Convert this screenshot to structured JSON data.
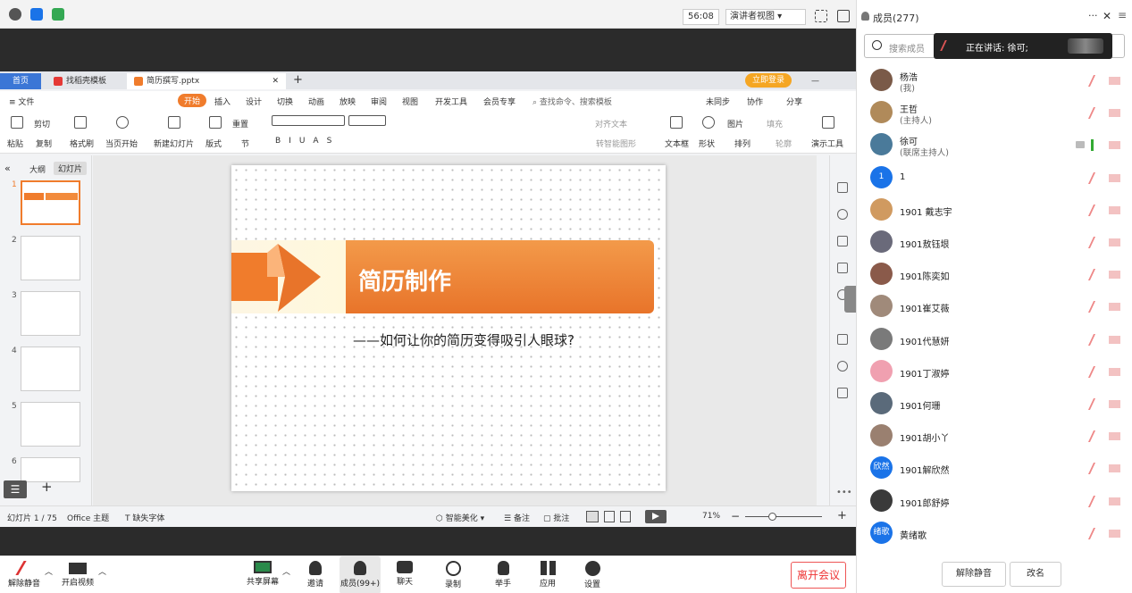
{
  "topbar": {
    "timer": "56:08",
    "view": "演讲者视图"
  },
  "wps": {
    "tabs": [
      {
        "label": "首页"
      },
      {
        "label": "找稻壳模板"
      },
      {
        "label": "简历撰写.pptx"
      }
    ],
    "login": "立即登录",
    "menu": [
      "≡ 文件",
      "开始",
      "插入",
      "设计",
      "切换",
      "动画",
      "放映",
      "审阅",
      "视图",
      "开发工具",
      "会员专享"
    ],
    "search": "查找命令、搜索模板",
    "right_menu": [
      "未同步",
      "协作",
      "分享"
    ],
    "ribbon": {
      "row1": [
        "剪切",
        "重置"
      ],
      "row2": [
        "粘贴",
        "复制",
        "格式刷",
        "当页开始",
        "新建幻灯片",
        "版式",
        "节",
        "文本框",
        "形状",
        "排列",
        "演示工具"
      ],
      "misc": [
        "对齐文本",
        "图片",
        "填充",
        "转智能图形",
        "轮廓"
      ]
    },
    "thumb_tabs": [
      "大纲",
      "幻灯片"
    ],
    "slide_numbers": [
      "1",
      "2",
      "3",
      "4",
      "5",
      "6"
    ],
    "slide": {
      "title": "简历制作",
      "subtitle": "——如何让你的简历变得吸引人眼球?"
    },
    "status": {
      "slide": "幻灯片 1 / 75",
      "theme": "Office 主题",
      "font": "缺失字体",
      "beautify": "智能美化",
      "notes": "备注",
      "comment": "批注",
      "zoom": "71%"
    }
  },
  "bottombar": {
    "items": [
      {
        "label": "解除静音"
      },
      {
        "label": "开启视频"
      },
      {
        "label": "共享屏幕"
      },
      {
        "label": "邀请"
      },
      {
        "label": "成员(99+)"
      },
      {
        "label": "聊天"
      },
      {
        "label": "录制"
      },
      {
        "label": "举手"
      },
      {
        "label": "应用"
      },
      {
        "label": "设置"
      }
    ],
    "leave": "离开会议"
  },
  "panel": {
    "title": "成员(277)",
    "search_placeholder": "搜索成员",
    "speaking": "正在讲话: 徐可;",
    "members": [
      {
        "name": "杨浩",
        "role": "(我)",
        "avatar": "",
        "color": "#7a5a48"
      },
      {
        "name": "王哲",
        "role": "(主持人)",
        "avatar": "",
        "color": "#b08a5a"
      },
      {
        "name": "徐可",
        "role": "(联席主持人)",
        "avatar": "",
        "color": "#4a7a9a"
      },
      {
        "name": "1",
        "role": "",
        "avatar": "1",
        "color": "#1a73e8"
      },
      {
        "name": "1901 戴志宇",
        "role": "",
        "avatar": "",
        "color": "#d09a60"
      },
      {
        "name": "1901敖钰垠",
        "role": "",
        "avatar": "",
        "color": "#6a6a7a"
      },
      {
        "name": "1901陈奕如",
        "role": "",
        "avatar": "",
        "color": "#8a5a4a"
      },
      {
        "name": "1901崔艾薇",
        "role": "",
        "avatar": "",
        "color": "#a08a7a"
      },
      {
        "name": "1901代慧妍",
        "role": "",
        "avatar": "",
        "color": "#7a7a7a"
      },
      {
        "name": "1901丁淑婷",
        "role": "",
        "avatar": "",
        "color": "#f0a0b0"
      },
      {
        "name": "1901何珊",
        "role": "",
        "avatar": "",
        "color": "#5a6a7a"
      },
      {
        "name": "1901胡小丫",
        "role": "",
        "avatar": "",
        "color": "#9a8070"
      },
      {
        "name": "1901解欣然",
        "role": "",
        "avatar": "欣然",
        "color": "#1a73e8"
      },
      {
        "name": "1901郎舒婷",
        "role": "",
        "avatar": "",
        "color": "#3a3a3a"
      },
      {
        "name": "黄绪歌",
        "role": "",
        "avatar": "绪歌",
        "color": "#1a73e8"
      }
    ],
    "unmute_all": "解除静音",
    "rename": "改名"
  }
}
